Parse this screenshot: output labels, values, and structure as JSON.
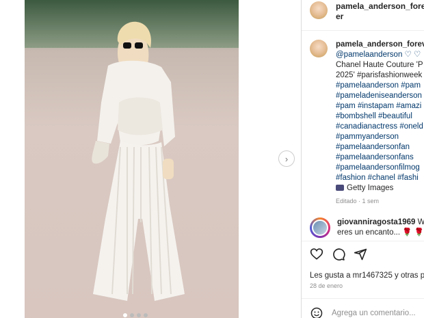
{
  "post": {
    "account": "pamela_anderson_forever",
    "caption_user": "pamela_anderson_forever",
    "caption_lines": [
      "@pamelaanderson ♡ ♡",
      "Chanel Haute Couture 'P",
      "2025' #parisfashionweek",
      "#pamelaanderson #pam",
      "#pameladeniseanderson",
      "#pam #instapam #amazi",
      "#bombshell #beautiful",
      "#canadianactress #oneld",
      "#pammyanderson",
      "#pamelaandersonfan",
      "#pamelaandersonfans",
      "#pamelaandersonfilmog",
      "#fashion #chanel #fashi"
    ],
    "credit": "Getty Images",
    "edited": "Editado · 1 sem",
    "comment": {
      "user": "giovanniragosta1969",
      "text": "WO",
      "line2": "eres un encanto... 🌹 🌹"
    },
    "likes_text": "Les gusta a mr1467325 y otras p",
    "date": "28 de enero",
    "add_comment_placeholder": "Agrega un comentario...",
    "next_label": "›"
  },
  "colors": {
    "link": "#00376b",
    "muted": "#8e8e8e",
    "divider": "#dbdbdb"
  }
}
